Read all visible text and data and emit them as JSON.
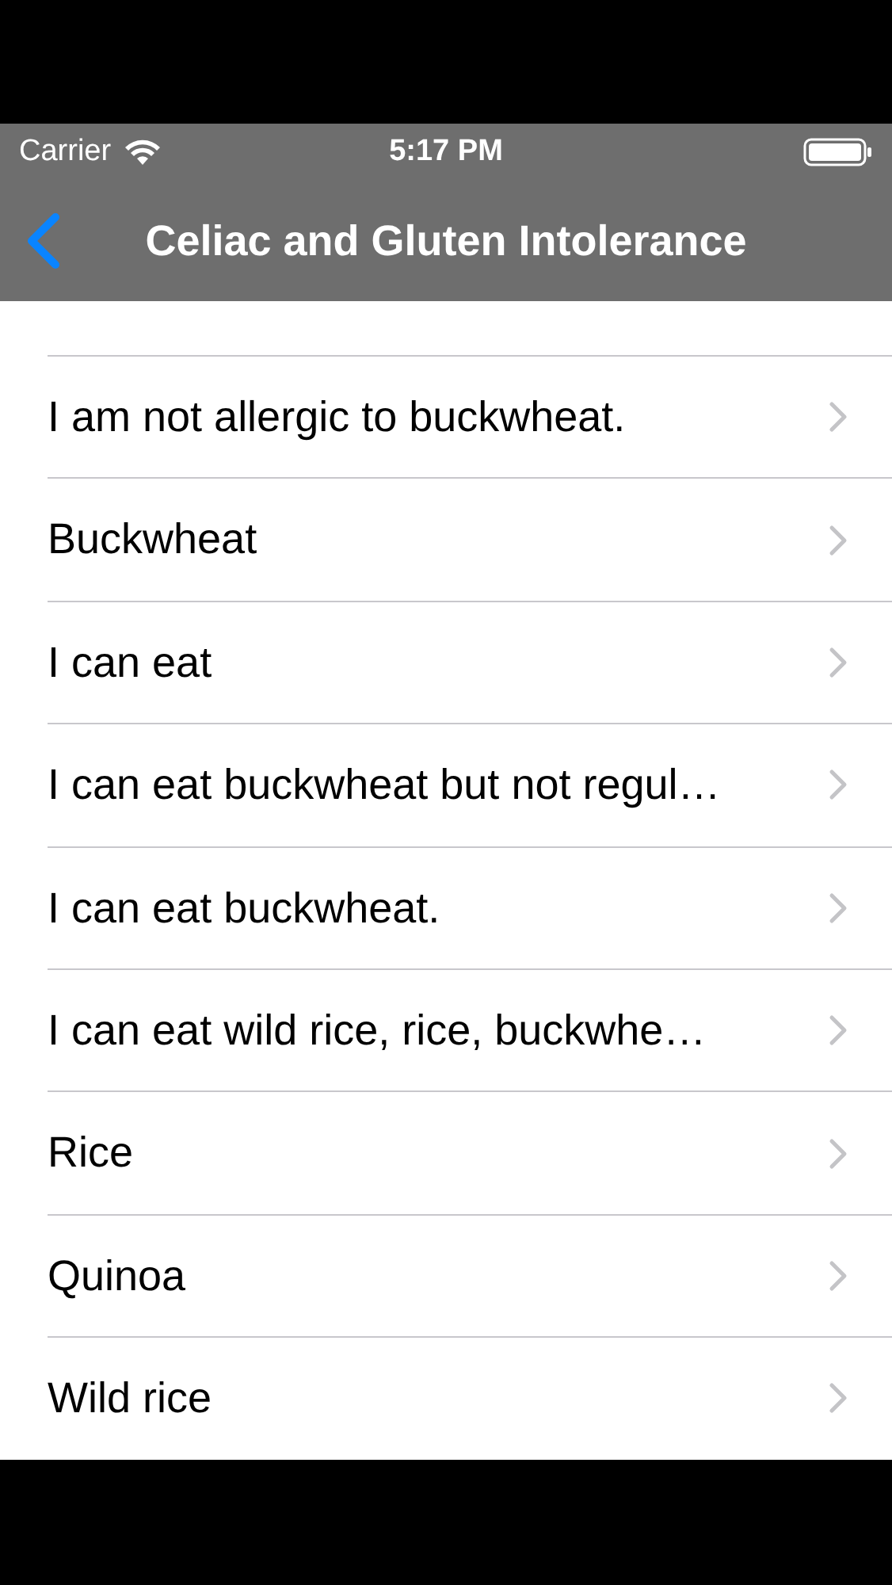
{
  "status_bar": {
    "carrier": "Carrier",
    "time": "5:17 PM"
  },
  "nav_bar": {
    "title": "Celiac and Gluten Intolerance"
  },
  "rows": [
    {
      "label": "I am not allergic to buckwheat."
    },
    {
      "label": "Buckwheat"
    },
    {
      "label": "I can eat"
    },
    {
      "label": "I can eat buckwheat but not regul…"
    },
    {
      "label": "I can eat buckwheat."
    },
    {
      "label": "I can eat wild rice, rice, buckwhe…"
    },
    {
      "label": "Rice"
    },
    {
      "label": "Quinoa"
    },
    {
      "label": "Wild rice"
    }
  ]
}
